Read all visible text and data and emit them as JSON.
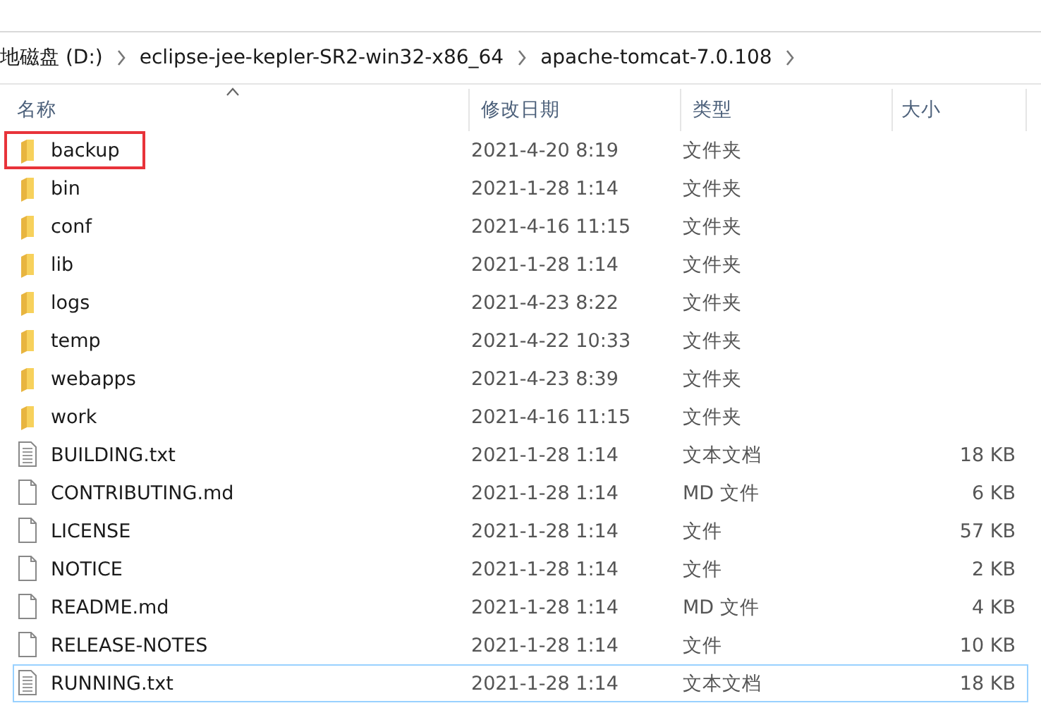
{
  "breadcrumb": [
    "地磁盘 (D:)",
    "eclipse-jee-kepler-SR2-win32-x86_64",
    "apache-tomcat-7.0.108"
  ],
  "columns": [
    {
      "label": "名称",
      "sorted": true
    },
    {
      "label": "修改日期",
      "sorted": false
    },
    {
      "label": "类型",
      "sorted": false
    },
    {
      "label": "大小",
      "sorted": false
    }
  ],
  "rows": [
    {
      "kind": "folder",
      "name": "backup",
      "date": "2021-4-20 8:19",
      "type": "文件夹",
      "highlighted": true,
      "focused": false
    },
    {
      "kind": "folder",
      "name": "bin",
      "date": "2021-1-28 1:14",
      "type": "文件夹",
      "highlighted": false,
      "focused": false
    },
    {
      "kind": "folder",
      "name": "conf",
      "date": "2021-4-16 11:15",
      "type": "文件夹",
      "highlighted": false,
      "focused": false
    },
    {
      "kind": "folder",
      "name": "lib",
      "date": "2021-1-28 1:14",
      "type": "文件夹",
      "highlighted": false,
      "focused": false
    },
    {
      "kind": "folder",
      "name": "logs",
      "date": "2021-4-23 8:22",
      "type": "文件夹",
      "highlighted": false,
      "focused": false
    },
    {
      "kind": "folder",
      "name": "temp",
      "date": "2021-4-22 10:33",
      "type": "文件夹",
      "highlighted": false,
      "focused": false
    },
    {
      "kind": "folder",
      "name": "webapps",
      "date": "2021-4-23 8:39",
      "type": "文件夹",
      "highlighted": false,
      "focused": false
    },
    {
      "kind": "folder",
      "name": "work",
      "date": "2021-4-16 11:15",
      "type": "文件夹",
      "highlighted": false,
      "focused": false
    },
    {
      "kind": "text",
      "name": "BUILDING.txt",
      "date": "2021-1-28 1:14",
      "type": "文本文档",
      "size": "18 KB",
      "highlighted": false,
      "focused": false
    },
    {
      "kind": "file",
      "name": "CONTRIBUTING.md",
      "date": "2021-1-28 1:14",
      "type": "MD 文件",
      "size": "6 KB",
      "highlighted": false,
      "focused": false
    },
    {
      "kind": "file",
      "name": "LICENSE",
      "date": "2021-1-28 1:14",
      "type": "文件",
      "size": "57 KB",
      "highlighted": false,
      "focused": false
    },
    {
      "kind": "file",
      "name": "NOTICE",
      "date": "2021-1-28 1:14",
      "type": "文件",
      "size": "2 KB",
      "highlighted": false,
      "focused": false
    },
    {
      "kind": "file",
      "name": "README.md",
      "date": "2021-1-28 1:14",
      "type": "MD 文件",
      "size": "4 KB",
      "highlighted": false,
      "focused": false
    },
    {
      "kind": "file",
      "name": "RELEASE-NOTES",
      "date": "2021-1-28 1:14",
      "type": "文件",
      "size": "10 KB",
      "highlighted": false,
      "focused": false
    },
    {
      "kind": "text",
      "name": "RUNNING.txt",
      "date": "2021-1-28 1:14",
      "type": "文本文档",
      "size": "18 KB",
      "highlighted": false,
      "focused": true
    }
  ]
}
